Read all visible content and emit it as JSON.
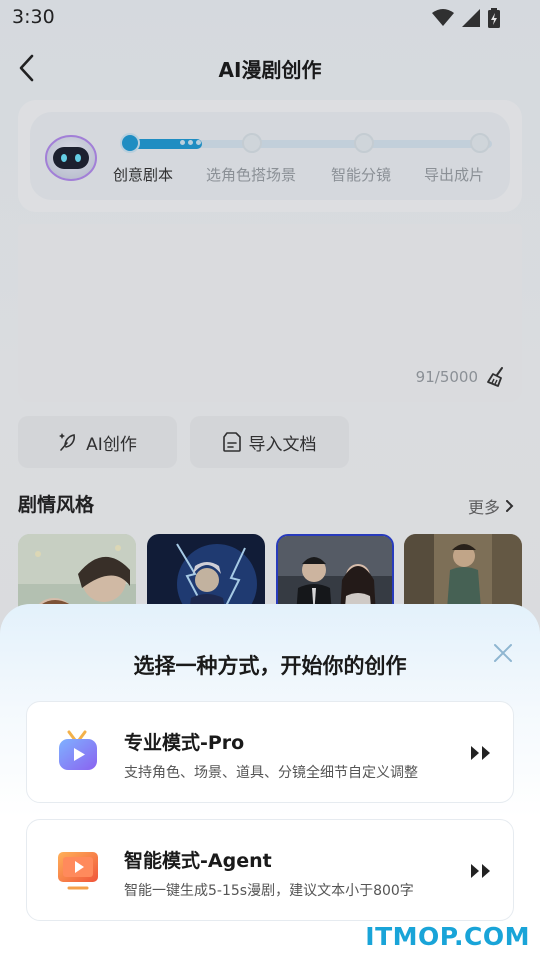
{
  "status_bar": {
    "time": "3:30"
  },
  "header": {
    "title": "AI漫剧创作"
  },
  "steps": {
    "items": [
      {
        "label": "创意剧本"
      },
      {
        "label": "选角色搭场景"
      },
      {
        "label": "智能分镜"
      },
      {
        "label": "导出成片"
      }
    ],
    "current": 1
  },
  "editor": {
    "char_count": "91/5000"
  },
  "actions": {
    "ai_create": "AI创作",
    "import_doc": "导入文档"
  },
  "styles_section": {
    "title": "剧情风格",
    "more": "更多"
  },
  "sheet": {
    "title": "选择一种方式，开始你的创作",
    "modes": [
      {
        "title": "专业模式-Pro",
        "desc": "支持角色、场景、道具、分镜全细节自定义调整"
      },
      {
        "title": "智能模式-Agent",
        "desc": "智能一键生成5-15s漫剧，建议文本小于800字"
      }
    ]
  },
  "watermark": "ITMOP.COM",
  "colors": {
    "accent": "#1f9cd8",
    "selected_border": "#2a3fd1",
    "watermark": "#19a4d8"
  }
}
